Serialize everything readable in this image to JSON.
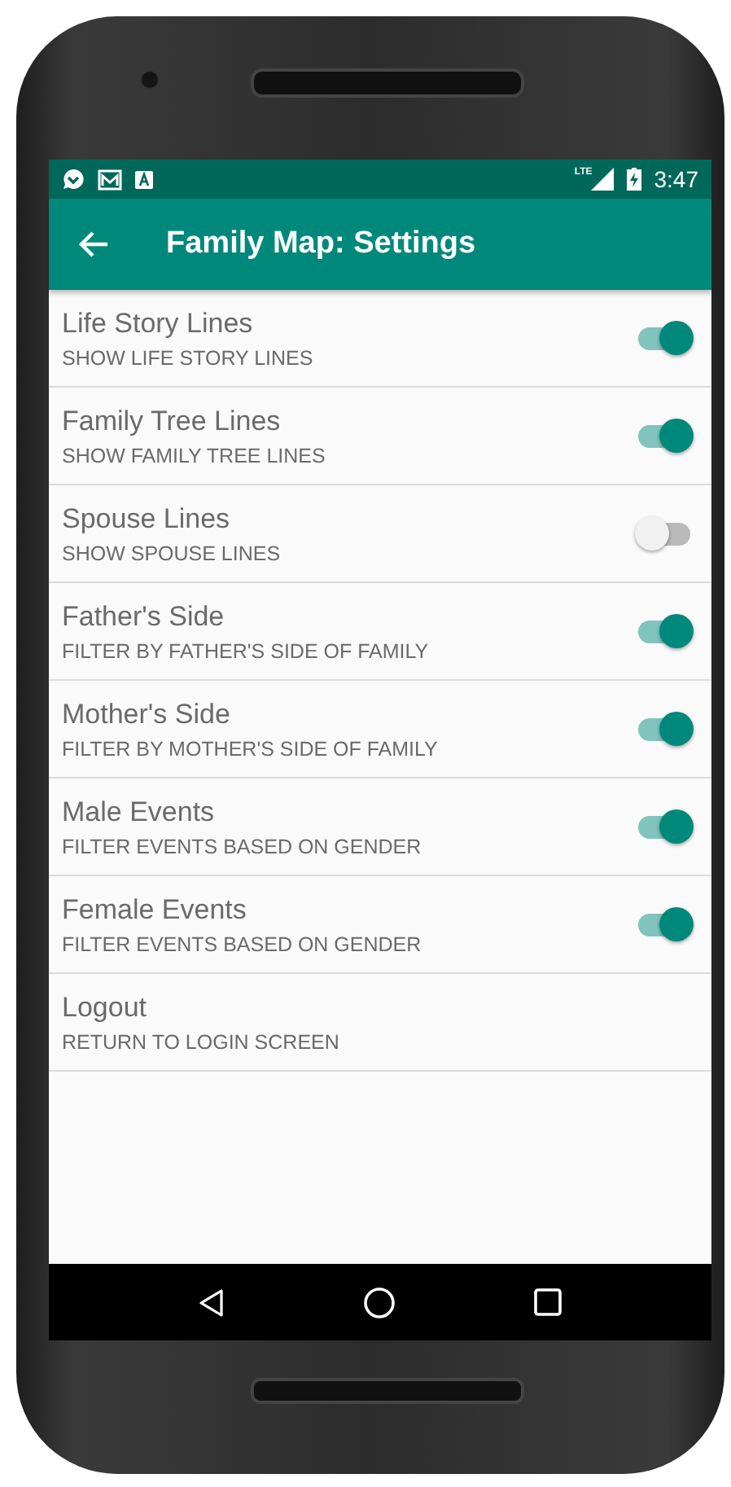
{
  "status_bar": {
    "network": "LTE",
    "time": "3:47"
  },
  "app_bar": {
    "title": "Family Map: Settings"
  },
  "settings": [
    {
      "kind": "switch",
      "title": "Life Story Lines",
      "subtitle": "SHOW LIFE STORY LINES",
      "on": true
    },
    {
      "kind": "switch",
      "title": "Family Tree Lines",
      "subtitle": "SHOW FAMILY TREE LINES",
      "on": true
    },
    {
      "kind": "switch",
      "title": "Spouse Lines",
      "subtitle": "SHOW SPOUSE LINES",
      "on": false
    },
    {
      "kind": "switch",
      "title": "Father's Side",
      "subtitle": "FILTER BY FATHER'S SIDE OF FAMILY",
      "on": true
    },
    {
      "kind": "switch",
      "title": "Mother's Side",
      "subtitle": "FILTER BY MOTHER'S SIDE OF FAMILY",
      "on": true
    },
    {
      "kind": "switch",
      "title": "Male Events",
      "subtitle": "FILTER EVENTS BASED ON GENDER",
      "on": true
    },
    {
      "kind": "switch",
      "title": "Female Events",
      "subtitle": "FILTER EVENTS BASED ON GENDER",
      "on": true
    },
    {
      "kind": "action",
      "title": "Logout",
      "subtitle": "RETURN TO LOGIN SCREEN"
    }
  ]
}
